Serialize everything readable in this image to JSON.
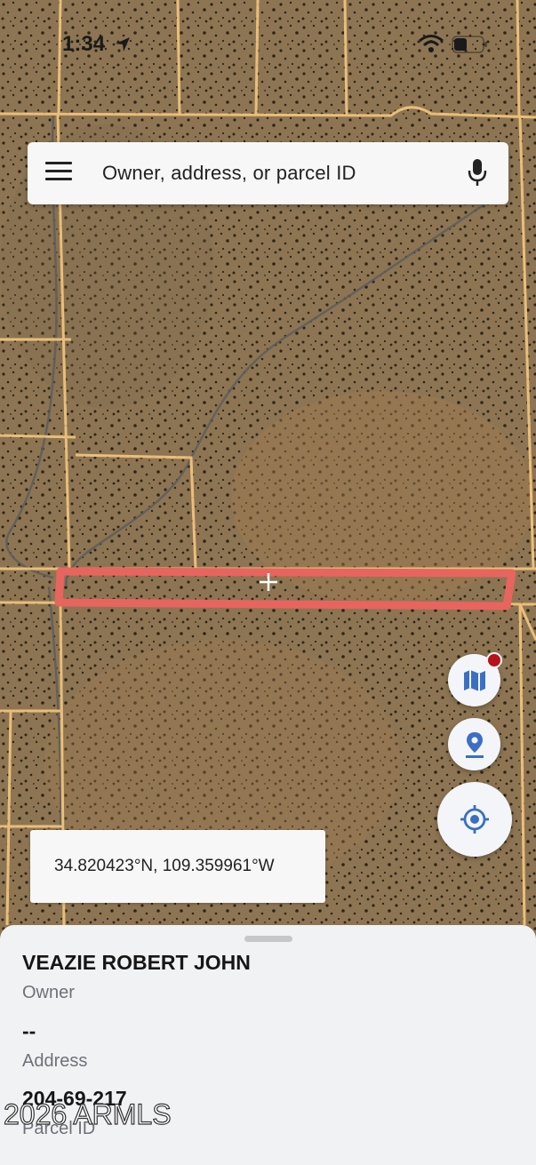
{
  "status_bar": {
    "time": "1:34"
  },
  "search": {
    "placeholder": "Owner, address, or parcel ID"
  },
  "map": {
    "coordinates": "34.820423°N, 109.359961°W",
    "parcel_outline_color": "#e8645f",
    "parcel_line_color": "#f5c77e"
  },
  "parcel": {
    "owner_value": "VEAZIE ROBERT JOHN",
    "owner_label": "Owner",
    "address_value": "--",
    "address_label": "Address",
    "parcel_id_value": "204-69-217",
    "parcel_id_label": "Parcel ID"
  },
  "watermark": "2026 ARMLS",
  "colors": {
    "accent": "#3a6fc4",
    "notification": "#b5121b"
  }
}
